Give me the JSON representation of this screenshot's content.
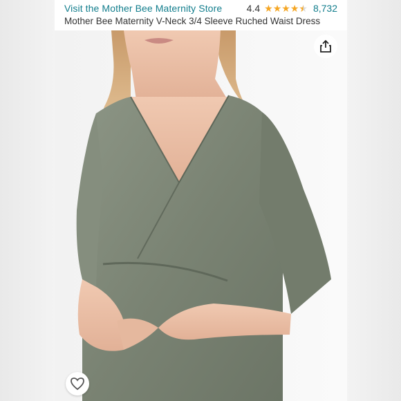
{
  "header": {
    "store_link": "Visit the Mother Bee Maternity Store",
    "rating_value": "4.4",
    "rating_stars": 4.4,
    "review_count": "8,732",
    "product_title": "Mother Bee Maternity V-Neck 3/4 Sleeve Ruched Waist Dress"
  },
  "icons": {
    "share": "share-icon",
    "favorite": "heart-icon",
    "star": "star-icon"
  },
  "colors": {
    "link": "#117d8c",
    "star": "#f5a623",
    "dress": "#7d8676",
    "skin": "#e9c3ac"
  }
}
